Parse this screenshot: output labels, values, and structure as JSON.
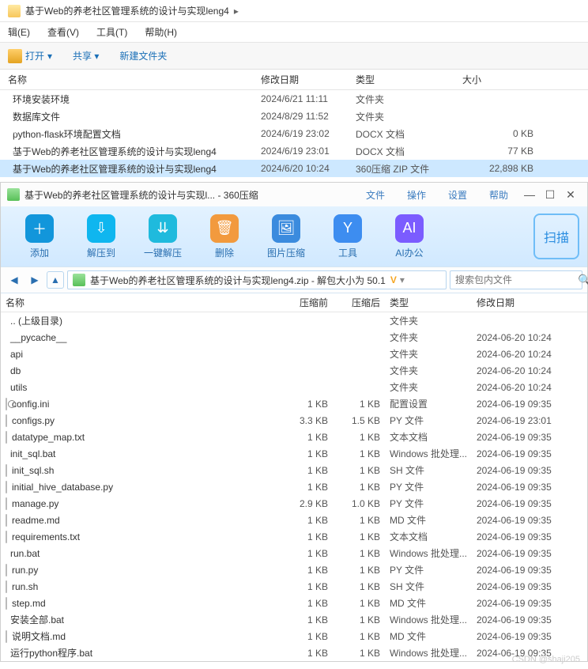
{
  "breadcrumb": {
    "folder": "基于Web的养老社区管理系统的设计与实现leng4"
  },
  "menubar": {
    "edit": "辑(E)",
    "view": "查看(V)",
    "tools": "工具(T)",
    "help": "帮助(H)"
  },
  "exp_toolbar": {
    "open": "打开",
    "share": "共享",
    "newfolder": "新建文件夹"
  },
  "exp_head": {
    "name": "名称",
    "date": "修改日期",
    "type": "类型",
    "size": "大小"
  },
  "exp_rows": [
    {
      "name": "环境安装环境",
      "date": "2024/6/21 11:11",
      "type": "文件夹",
      "size": "",
      "ic": "fold"
    },
    {
      "name": "数据库文件",
      "date": "2024/8/29 11:52",
      "type": "文件夹",
      "size": "",
      "ic": "fold"
    },
    {
      "name": "python-flask环境配置文档",
      "date": "2024/6/19 23:02",
      "type": "DOCX 文档",
      "size": "0 KB",
      "ic": "docx"
    },
    {
      "name": "基于Web的养老社区管理系统的设计与实现leng4",
      "date": "2024/6/19 23:01",
      "type": "DOCX 文档",
      "size": "77 KB",
      "ic": "docx"
    },
    {
      "name": "基于Web的养老社区管理系统的设计与实现leng4",
      "date": "2024/6/20 10:24",
      "type": "360压缩 ZIP 文件",
      "size": "22,898 KB",
      "ic": "zip",
      "sel": true
    }
  ],
  "zip_title": {
    "text": "基于Web的养老社区管理系统的设计与实现l... - 360压缩",
    "file": "文件",
    "op": "操作",
    "set": "设置",
    "help": "帮助"
  },
  "zip_tools": {
    "add": "添加",
    "ext": "解压到",
    "one": "一键解压",
    "del": "删除",
    "img": "图片压缩",
    "tool": "工具",
    "ai": "AI办公",
    "scan": "扫描"
  },
  "zip_path": {
    "text": "基于Web的养老社区管理系统的设计与实现leng4.zip - 解包大小为 50.1",
    "vip": "V",
    "search_placeholder": "搜索包内文件"
  },
  "zip_head": {
    "name": "名称",
    "pre": "压缩前",
    "post": "压缩后",
    "type": "类型",
    "date": "修改日期"
  },
  "zip_rows": [
    {
      "name": ".. (上级目录)",
      "pre": "",
      "post": "",
      "type": "文件夹",
      "date": "",
      "ic": "fold"
    },
    {
      "name": "__pycache__",
      "pre": "",
      "post": "",
      "type": "文件夹",
      "date": "2024-06-20 10:24",
      "ic": "fold"
    },
    {
      "name": "api",
      "pre": "",
      "post": "",
      "type": "文件夹",
      "date": "2024-06-20 10:24",
      "ic": "fold"
    },
    {
      "name": "db",
      "pre": "",
      "post": "",
      "type": "文件夹",
      "date": "2024-06-20 10:24",
      "ic": "fold"
    },
    {
      "name": "utils",
      "pre": "",
      "post": "",
      "type": "文件夹",
      "date": "2024-06-20 10:24",
      "ic": "fold"
    },
    {
      "name": "config.ini",
      "pre": "1 KB",
      "post": "1 KB",
      "type": "配置设置",
      "date": "2024-06-19 09:35",
      "ic": "ini"
    },
    {
      "name": "configs.py",
      "pre": "3.3 KB",
      "post": "1.5 KB",
      "type": "PY 文件",
      "date": "2024-06-19 23:01",
      "ic": "py"
    },
    {
      "name": "datatype_map.txt",
      "pre": "1 KB",
      "post": "1 KB",
      "type": "文本文档",
      "date": "2024-06-19 09:35",
      "ic": "txt"
    },
    {
      "name": "init_sql.bat",
      "pre": "1 KB",
      "post": "1 KB",
      "type": "Windows 批处理...",
      "date": "2024-06-19 09:35",
      "ic": "bat"
    },
    {
      "name": "init_sql.sh",
      "pre": "1 KB",
      "post": "1 KB",
      "type": "SH 文件",
      "date": "2024-06-19 09:35",
      "ic": "sh"
    },
    {
      "name": "initial_hive_database.py",
      "pre": "1 KB",
      "post": "1 KB",
      "type": "PY 文件",
      "date": "2024-06-19 09:35",
      "ic": "py"
    },
    {
      "name": "manage.py",
      "pre": "2.9 KB",
      "post": "1.0 KB",
      "type": "PY 文件",
      "date": "2024-06-19 09:35",
      "ic": "py"
    },
    {
      "name": "readme.md",
      "pre": "1 KB",
      "post": "1 KB",
      "type": "MD 文件",
      "date": "2024-06-19 09:35",
      "ic": "md"
    },
    {
      "name": "requirements.txt",
      "pre": "1 KB",
      "post": "1 KB",
      "type": "文本文档",
      "date": "2024-06-19 09:35",
      "ic": "txt"
    },
    {
      "name": "run.bat",
      "pre": "1 KB",
      "post": "1 KB",
      "type": "Windows 批处理...",
      "date": "2024-06-19 09:35",
      "ic": "bat"
    },
    {
      "name": "run.py",
      "pre": "1 KB",
      "post": "1 KB",
      "type": "PY 文件",
      "date": "2024-06-19 09:35",
      "ic": "py"
    },
    {
      "name": "run.sh",
      "pre": "1 KB",
      "post": "1 KB",
      "type": "SH 文件",
      "date": "2024-06-19 09:35",
      "ic": "sh"
    },
    {
      "name": "step.md",
      "pre": "1 KB",
      "post": "1 KB",
      "type": "MD 文件",
      "date": "2024-06-19 09:35",
      "ic": "md"
    },
    {
      "name": "安装全部.bat",
      "pre": "1 KB",
      "post": "1 KB",
      "type": "Windows 批处理...",
      "date": "2024-06-19 09:35",
      "ic": "bat"
    },
    {
      "name": "说明文档.md",
      "pre": "1 KB",
      "post": "1 KB",
      "type": "MD 文件",
      "date": "2024-06-19 09:35",
      "ic": "md"
    },
    {
      "name": "运行python程序.bat",
      "pre": "1 KB",
      "post": "1 KB",
      "type": "Windows 批处理...",
      "date": "2024-06-19 09:35",
      "ic": "bat"
    }
  ],
  "watermark": "CSDN @shaji205"
}
